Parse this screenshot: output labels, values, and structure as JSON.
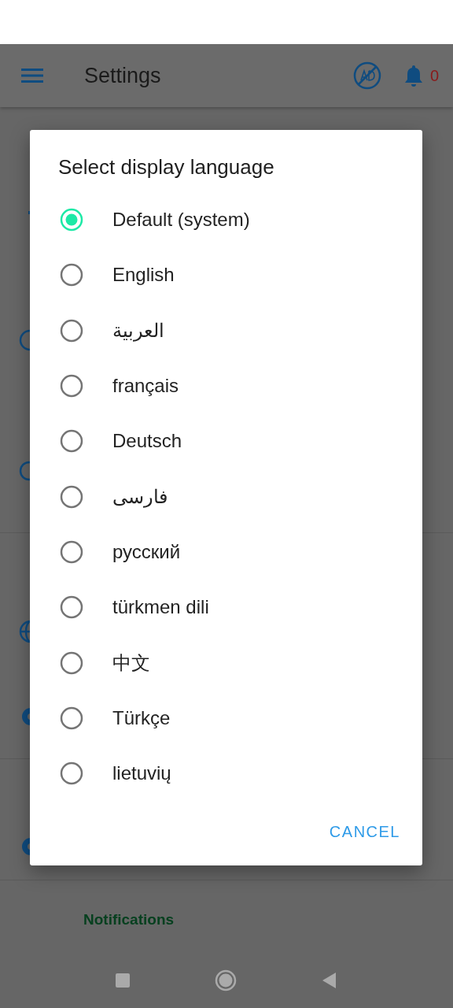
{
  "app_bar": {
    "title": "Settings",
    "notification_count": "0"
  },
  "section": {
    "title": "Notifications"
  },
  "dialog": {
    "title": "Select display language",
    "options": [
      {
        "label": "Default (system)",
        "selected": true
      },
      {
        "label": "English",
        "selected": false
      },
      {
        "label": "العربية",
        "selected": false
      },
      {
        "label": "français",
        "selected": false
      },
      {
        "label": "Deutsch",
        "selected": false
      },
      {
        "label": "فارسی",
        "selected": false
      },
      {
        "label": "русский",
        "selected": false
      },
      {
        "label": "türkmen dili",
        "selected": false
      },
      {
        "label": "中文",
        "selected": false
      },
      {
        "label": "Türkçe",
        "selected": false
      },
      {
        "label": "lietuvių",
        "selected": false
      }
    ],
    "cancel": "CANCEL"
  }
}
